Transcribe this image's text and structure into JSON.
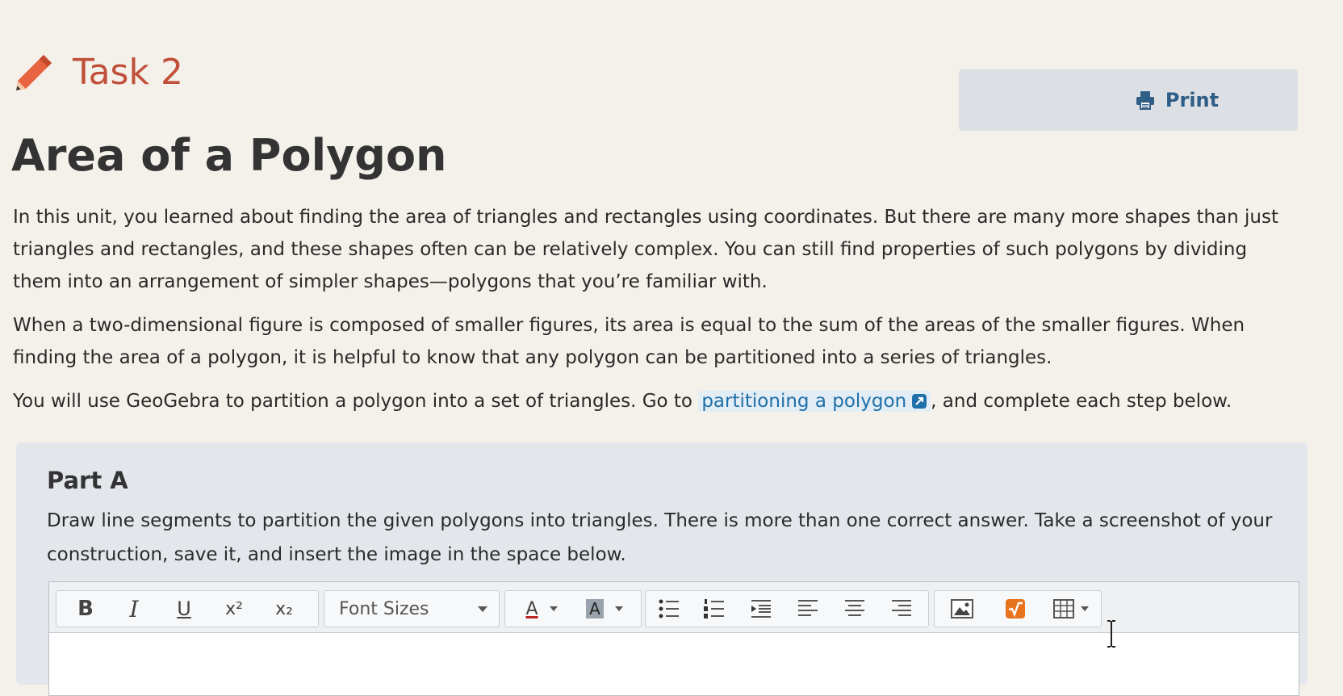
{
  "task": {
    "label": "Task 2",
    "icon": "pencil-icon"
  },
  "print": {
    "label": "Print",
    "icon": "printer-icon"
  },
  "page_title": "Area of a Polygon",
  "paragraphs": {
    "intro": "In this unit, you learned about finding the area of triangles and rectangles using coordinates. But there are many more shapes than just triangles and rectangles, and these shapes often can be relatively complex. You can still find properties of such polygons by dividing them into an arrangement of simpler shapes—polygons that you’re familiar with.",
    "composition": "When a two-dimensional figure is composed of smaller figures, its area is equal to the sum of the areas of the smaller figures. When finding the area of a polygon, it is helpful to know that any polygon can be partitioned into a series of triangles.",
    "geogebra_before": "You will use GeoGebra to partition a polygon into a set of triangles. Go to ",
    "geogebra_link": "partitioning a polygon",
    "geogebra_after": ", and complete each step below."
  },
  "part_a": {
    "title": "Part A",
    "instructions": "Draw line segments to partition the given polygons into triangles. There is more than one correct answer. Take a screenshot of your construction, save it, and insert the image in the space below."
  },
  "editor_toolbar": {
    "bold": "B",
    "italic": "I",
    "underline": "U",
    "superscript": "x²",
    "subscript": "x₂",
    "font_sizes": "Font Sizes",
    "font_color": "A",
    "highlight_color": "A"
  },
  "colors": {
    "task_accent": "#c0503a",
    "link": "#1f6fa8",
    "print_text": "#2f5e86",
    "panel_bg": "#e3e7ec",
    "math_icon": "#e8731d"
  }
}
